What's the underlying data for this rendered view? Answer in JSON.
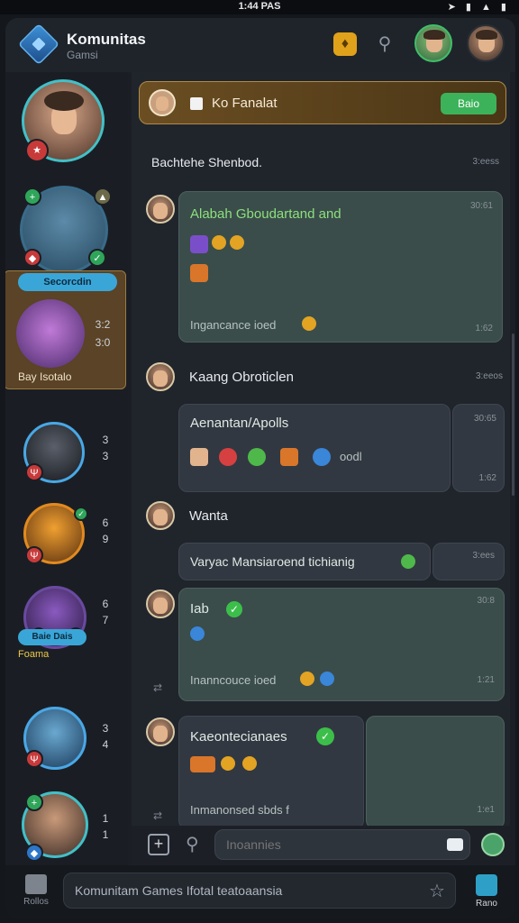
{
  "status_bar": {
    "time": "1:44 PAS",
    "icons": "➤ ▮ ▲ ▮"
  },
  "header": {
    "title": "Komunitas",
    "subtitle": "Gamsi",
    "icons": [
      "logo-icon",
      "bell-icon",
      "search-icon",
      "avatar-1",
      "avatar-2"
    ]
  },
  "banner": {
    "title": "Ko Fanalat",
    "button": "Baio"
  },
  "section": {
    "title": "Bachtehe Shenbod.",
    "time": "3:eess"
  },
  "sidebar": {
    "active_label": "Secorcdin",
    "active_nums": [
      "3:2",
      "3:0"
    ],
    "active_caption": "Bay Isotalo",
    "nums": [
      [
        "3",
        "3"
      ],
      [
        "6",
        "9"
      ],
      [
        "6",
        "7"
      ],
      [
        "3",
        "4"
      ],
      [
        "1",
        "1"
      ]
    ],
    "small_pill": "Baie Dais",
    "small_caption": "Foama"
  },
  "messages": [
    {
      "title": "Alabah Gboudartand and",
      "time": "30:61",
      "sub": "Ingancance ioed",
      "sub_time": "1:62"
    },
    {
      "name": "Kaang Obroticlen",
      "name_time": "3:eeos",
      "title": "Aenantan/Apolls",
      "time": "30:65",
      "emoji_label": "oodl",
      "sub_time": "1:62"
    },
    {
      "name": "Wanta",
      "title": "Varyac Mansiaroend tichianig",
      "time": "3:ees"
    },
    {
      "title": "Iab",
      "time": "30:8",
      "sub": "Inanncouce ioed",
      "sub_time": "1:21"
    },
    {
      "title": "Kaeontecianaes",
      "sub": "Inmanonsed sbds f",
      "sub_time": "1:e1"
    }
  ],
  "composer": {
    "placeholder": "Inoannies"
  },
  "bottom_nav": {
    "left_label": "Rollos",
    "input_text": "Komunitam Games Ifotal teatoaansia",
    "right_label": "Rano"
  },
  "colors": {
    "accent": "#3aa6d8",
    "success": "#3cb35a",
    "gold": "#e0a21a",
    "bubble": "#3a4d4b"
  }
}
